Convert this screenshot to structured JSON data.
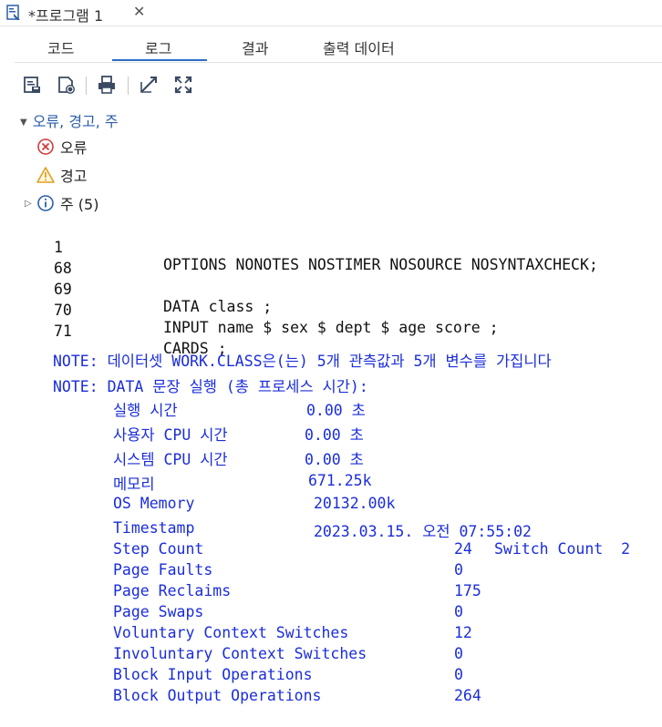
{
  "window": {
    "tab_title": "*프로그램 1",
    "close_label": "✕"
  },
  "subtabs": [
    {
      "label": "코드",
      "active": false
    },
    {
      "label": "로그",
      "active": true
    },
    {
      "label": "결과",
      "active": false
    },
    {
      "label": "출력 데이터",
      "active": false
    }
  ],
  "toolbar": {
    "icons": [
      "save-log-icon",
      "save-html-icon",
      "print-icon",
      "open-external-icon",
      "maximize-icon"
    ]
  },
  "tree": {
    "header": "오류, 경고, 주",
    "items": [
      {
        "label": "오류",
        "icon": "error-icon"
      },
      {
        "label": "경고",
        "icon": "warning-icon"
      },
      {
        "label": "주 (5)",
        "icon": "info-icon"
      }
    ]
  },
  "log": {
    "source_lines": [
      {
        "num": "1",
        "code": "OPTIONS NONOTES NOSTIMER NOSOURCE NOSYNTAXCHECK;"
      },
      {
        "num": "68",
        "code": ""
      },
      {
        "num": "69",
        "code": "DATA class ;"
      },
      {
        "num": "70",
        "code": "INPUT name $ sex $ dept $ age score ;"
      },
      {
        "num": "71",
        "code": "CARDS ;"
      }
    ],
    "note1": "NOTE: 데이터셋 WORK.CLASS은(는) 5개 관측값과 5개 변수를 가집니다",
    "note2": "NOTE: DATA 문장 실행 (총 프로세스 시간):",
    "stats_a": [
      {
        "label": "실행 시간",
        "value": "0.00 초"
      },
      {
        "label": "사용자 CPU 시간",
        "value": "0.00 초"
      },
      {
        "label": "시스템 CPU 시간",
        "value": "0.00 초"
      },
      {
        "label": "메모리",
        "value": "671.25k"
      },
      {
        "label": "OS Memory",
        "value": "20132.00k"
      },
      {
        "label": "Timestamp",
        "value": "2023.03.15. 오전 07:55:02"
      }
    ],
    "stats_b": [
      {
        "label": "Step Count",
        "value": "24",
        "extra": "Switch Count  2"
      },
      {
        "label": "Page Faults",
        "value": "0"
      },
      {
        "label": "Page Reclaims",
        "value": "175"
      },
      {
        "label": "Page Swaps",
        "value": "0"
      },
      {
        "label": "Voluntary Context Switches",
        "value": "12"
      },
      {
        "label": "Involuntary Context Switches",
        "value": "0"
      },
      {
        "label": "Block Input Operations",
        "value": "0"
      },
      {
        "label": "Block Output Operations",
        "value": "264"
      }
    ]
  },
  "colors": {
    "note_blue": "#1a2ddb",
    "tab_accent": "#2b6cc4"
  }
}
